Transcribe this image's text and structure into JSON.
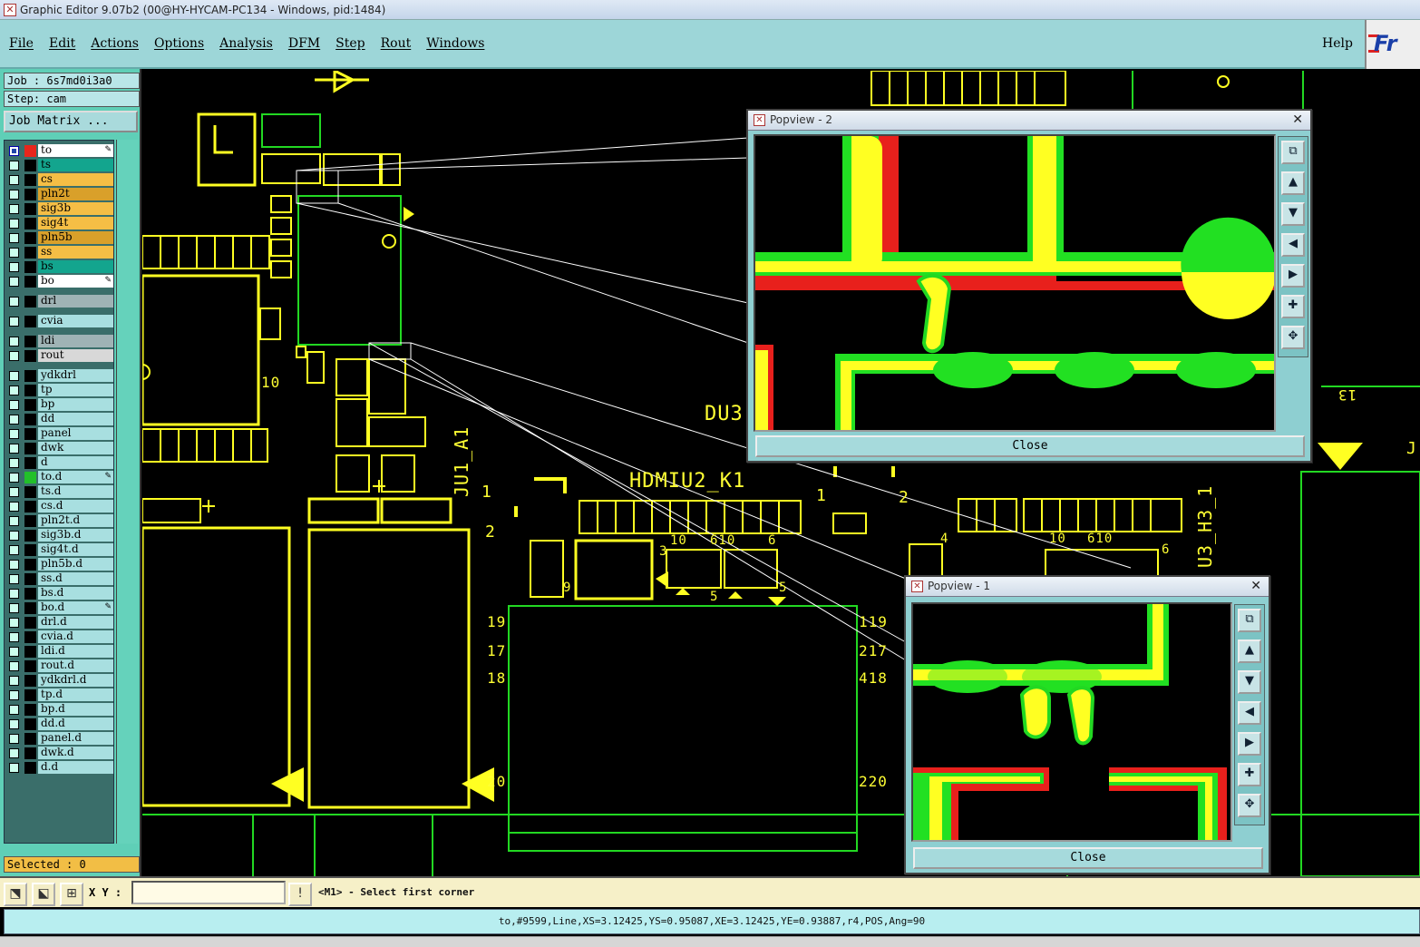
{
  "window": {
    "title": "Graphic Editor 9.07b2 (00@HY-HYCAM-PC134 - Windows, pid:1484)"
  },
  "menu": {
    "items": [
      "File",
      "Edit",
      "Actions",
      "Options",
      "Analysis",
      "DFM",
      "Step",
      "Rout",
      "Windows"
    ],
    "help": "Help",
    "logo_text": "Fr"
  },
  "job": {
    "job_label": "Job : 6s7md0i3a0",
    "step_label": "Step: cam",
    "matrix_button": "Job Matrix ..."
  },
  "layers": [
    {
      "name": "to",
      "color": "#ffffff",
      "swatch": "#e8261c",
      "on": true,
      "edit": true
    },
    {
      "name": "ts",
      "color": "#13a58e",
      "swatch": "#000000"
    },
    {
      "name": "cs",
      "color": "#f5be45",
      "swatch": "#000000"
    },
    {
      "name": "pln2t",
      "color": "#d9a02a",
      "swatch": "#000000"
    },
    {
      "name": "sig3b",
      "color": "#f5be45",
      "swatch": "#000000"
    },
    {
      "name": "sig4t",
      "color": "#f5be45",
      "swatch": "#000000"
    },
    {
      "name": "pln5b",
      "color": "#d9a02a",
      "swatch": "#000000"
    },
    {
      "name": "ss",
      "color": "#f5be45",
      "swatch": "#000000"
    },
    {
      "name": "bs",
      "color": "#13a58e",
      "swatch": "#000000"
    },
    {
      "name": "bo",
      "color": "#ffffff",
      "swatch": "#000000",
      "edit": true
    },
    {
      "name": "drl",
      "color": "#9fb3b5",
      "swatch": "#000000",
      "gap": true
    },
    {
      "name": "cvia",
      "color": "#a8dfe0",
      "swatch": "#000000",
      "gap": true
    },
    {
      "name": "ldi",
      "color": "#9fb3b5",
      "swatch": "#000000",
      "gap": true
    },
    {
      "name": "rout",
      "color": "#d8d8d8",
      "swatch": "#000000"
    },
    {
      "name": "ydkdrl",
      "color": "#a8dfe0",
      "swatch": "#000000",
      "gap": true
    },
    {
      "name": "tp",
      "color": "#a8dfe0",
      "swatch": "#000000"
    },
    {
      "name": "bp",
      "color": "#a8dfe0",
      "swatch": "#000000"
    },
    {
      "name": "dd",
      "color": "#a8dfe0",
      "swatch": "#000000"
    },
    {
      "name": "panel",
      "color": "#a8dfe0",
      "swatch": "#000000"
    },
    {
      "name": "dwk",
      "color": "#a8dfe0",
      "swatch": "#000000"
    },
    {
      "name": "d",
      "color": "#a8dfe0",
      "swatch": "#000000"
    },
    {
      "name": "to.d",
      "color": "#a8dfe0",
      "swatch": "#22c02a",
      "edit": true
    },
    {
      "name": "ts.d",
      "color": "#a8dfe0",
      "swatch": "#000000"
    },
    {
      "name": "cs.d",
      "color": "#a8dfe0",
      "swatch": "#000000"
    },
    {
      "name": "pln2t.d",
      "color": "#a8dfe0",
      "swatch": "#000000"
    },
    {
      "name": "sig3b.d",
      "color": "#a8dfe0",
      "swatch": "#000000"
    },
    {
      "name": "sig4t.d",
      "color": "#a8dfe0",
      "swatch": "#000000"
    },
    {
      "name": "pln5b.d",
      "color": "#a8dfe0",
      "swatch": "#000000"
    },
    {
      "name": "ss.d",
      "color": "#a8dfe0",
      "swatch": "#000000"
    },
    {
      "name": "bs.d",
      "color": "#a8dfe0",
      "swatch": "#000000"
    },
    {
      "name": "bo.d",
      "color": "#a8dfe0",
      "swatch": "#000000",
      "edit": true
    },
    {
      "name": "drl.d",
      "color": "#a8dfe0",
      "swatch": "#000000"
    },
    {
      "name": "cvia.d",
      "color": "#a8dfe0",
      "swatch": "#000000"
    },
    {
      "name": "ldi.d",
      "color": "#a8dfe0",
      "swatch": "#000000"
    },
    {
      "name": "rout.d",
      "color": "#a8dfe0",
      "swatch": "#000000"
    },
    {
      "name": "ydkdrl.d",
      "color": "#a8dfe0",
      "swatch": "#000000"
    },
    {
      "name": "tp.d",
      "color": "#a8dfe0",
      "swatch": "#000000"
    },
    {
      "name": "bp.d",
      "color": "#a8dfe0",
      "swatch": "#000000"
    },
    {
      "name": "dd.d",
      "color": "#a8dfe0",
      "swatch": "#000000"
    },
    {
      "name": "panel.d",
      "color": "#a8dfe0",
      "swatch": "#000000"
    },
    {
      "name": "dwk.d",
      "color": "#a8dfe0",
      "swatch": "#000000"
    },
    {
      "name": "d.d",
      "color": "#a8dfe0",
      "swatch": "#000000"
    }
  ],
  "selected": "Selected : 0",
  "canvas_labels": {
    "du3": "DU3",
    "hdmi": "HDMIU2_K1",
    "ju1": "JU1_A1",
    "h3": "U3_H3_1",
    "n10a": "10",
    "n1": "1",
    "n2": "2",
    "n1b": "1",
    "n2b": "2",
    "n19": "19",
    "n17": "17",
    "n18": "18",
    "n20": "20",
    "n119": "119",
    "n217": "217",
    "n418": "418",
    "n220": "220",
    "n13": "13",
    "n4": "4",
    "n10b": "10",
    "n6": "6",
    "n610": "610",
    "n6b": "6",
    "n10c": "10",
    "n610b": "610",
    "n6c": "6",
    "n5": "5",
    "n5b": "5",
    "n9": "9",
    "n3": "3",
    "jfrag": "J"
  },
  "popview2": {
    "title": "Popview - 2",
    "close": "Close",
    "close_x": "✕"
  },
  "popview1": {
    "title": "Popview - 1",
    "close": "Close",
    "close_x": "✕"
  },
  "cmd": {
    "xy_label": "X Y :",
    "xy_value": "",
    "prompt": "<M1> - Select first corner"
  },
  "status": "to,#9599,Line,XS=3.12425,YS=0.95087,XE=3.12425,YE=0.93887,r4,POS,Ang=90"
}
